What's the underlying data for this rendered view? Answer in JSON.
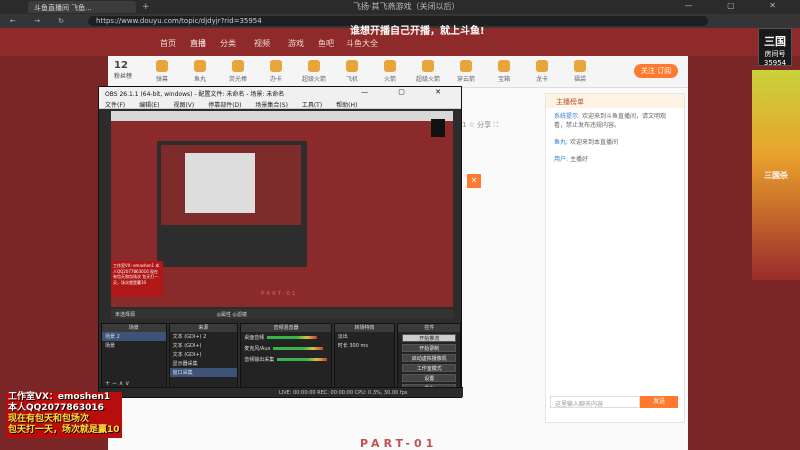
{
  "browser": {
    "tab_label": "斗鱼直播间 飞鱼...",
    "window_title": "飞扬·其飞燕游戏（关闭以后）",
    "url": "https://www.douyu.com/topic/djdyjr?rid=35954",
    "nav_icons": "← → ↻",
    "window_controls": "— ▢ ✕"
  },
  "site": {
    "nav_items": [
      "首页",
      "直播",
      "分类",
      "视频",
      "游戏",
      "鱼吧",
      "斗鱼大全"
    ],
    "banner_text": "谁想开播自己开播，就上斗鱼!",
    "logo_top": "三国",
    "logo_mid": "房间号",
    "logo_num": "35954",
    "day_count": "12",
    "day_label": "粉丝榜",
    "gifts": [
      "弹幕",
      "鱼丸",
      "荧光棒",
      "办卡",
      "超级火箭",
      "飞机",
      "火箭",
      "超级火箭",
      "穿云箭",
      "宝箱",
      "龙卡",
      "福袋"
    ],
    "subscribe_label": "关注 订阅"
  },
  "chat": {
    "header": "主播榜单",
    "messages": [
      {
        "name": "系统提示:",
        "text": "欢迎来到斗鱼直播间，请文明观看，禁止发布违规内容。"
      },
      {
        "name": "鱼丸:",
        "text": "欢迎来到本直播间"
      },
      {
        "name": "用户:",
        "text": "主播好"
      }
    ],
    "input_placeholder": "这里输入聊天内容",
    "send_label": "发送"
  },
  "right_ad_text": "三国杀",
  "part_label": "PART-01",
  "video_toolbar": "1  ☆ 分享  ⛶",
  "obs": {
    "title": "OBS 26.1.1 (64-bit, windows) - 配置文件: 未命名 - 场景: 未命名",
    "title_controls": "— ▢ ✕",
    "menu": [
      "文件(F)",
      "编辑(E)",
      "视图(V)",
      "停靠部件(D)",
      "场景集合(S)",
      "工具(T)",
      "帮助(H)"
    ],
    "scene_label": "未选择源",
    "scene_props": "◎属性   ◎滤镜",
    "docks": {
      "scenes": {
        "title": "场景",
        "items": [
          "场景 2",
          "场景"
        ]
      },
      "sources": {
        "title": "来源",
        "items": [
          "文本 (GDI+) 2",
          "文本 (GDI+)",
          "文本 (GDI+)",
          "显示器采集",
          "窗口采集"
        ]
      },
      "mixer": {
        "title": "音频混音器",
        "items": [
          "桌面音频",
          "麦克风/Aux",
          "音频输出采集"
        ]
      },
      "transitions": {
        "title": "转场特效",
        "fade": "淡出",
        "duration_label": "时长",
        "duration": "300 ms"
      },
      "controls": {
        "title": "控件",
        "buttons": [
          "开始推流",
          "开始录制",
          "启动虚拟摄像机",
          "工作室模式",
          "设置",
          "退出"
        ]
      }
    },
    "status": "LIVE: 00:00:00   REC: 00:00:00   CPU: 0.3%, 30.00 fps"
  },
  "nested_overlay": "工作室VX: emoshen1 本人QQ2077863016 现在有包天和包场次 包天打一天，场次就是赢10",
  "promo": [
    "工作室VX：emoshen1",
    "本人QQ2077863016",
    "现在有包天和包场次",
    "包天打一天，场次就是赢10"
  ]
}
